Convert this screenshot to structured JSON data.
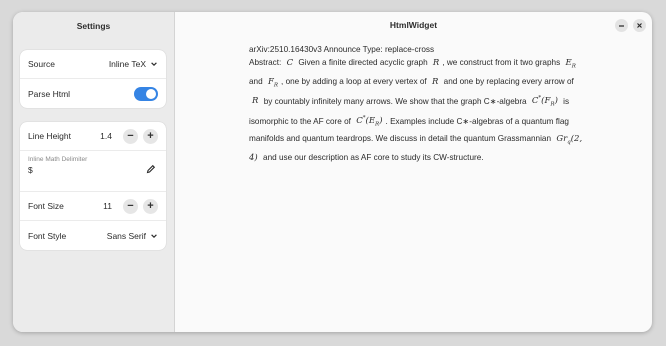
{
  "sidebar": {
    "title": "Settings",
    "source": {
      "label": "Source",
      "value": "Inline TeX"
    },
    "parse_html": {
      "label": "Parse Html",
      "enabled": true
    },
    "line_height": {
      "label": "Line Height",
      "value": "1.4",
      "minus": "−",
      "plus": "+"
    },
    "inline_math_delimiter": {
      "caption": "Inline Math Delimiter",
      "value": "$"
    },
    "font_size": {
      "label": "Font Size",
      "value": "11",
      "minus": "−",
      "plus": "+"
    },
    "font_style": {
      "label": "Font Style",
      "value": "Sans Serif"
    }
  },
  "main": {
    "title": "HtmlWidget",
    "header_line": "arXiv:2510.16430v3 Announce Type: replace-cross",
    "abstract_label": "Abstract:",
    "math": {
      "C": "C",
      "R": "R",
      "E": "E",
      "F": "F",
      "sub_R": "R",
      "cstar": "C",
      "star": "*",
      "open": "(",
      "close": ")",
      "Gr": "Gr",
      "sub_q": "q",
      "args": "(2, 4)"
    },
    "text": {
      "t1": "Given a finite directed acyclic graph",
      "t2": ", we construct from it two graphs",
      "t3": "and",
      "t4": ", one by adding a loop at every vertex of",
      "t5": "and one by replacing every arrow of",
      "t6": "by countably infinitely many arrows. We show that the graph C∗-algebra",
      "t7": "is isomorphic to the AF core of",
      "t8": ". Examples include C∗-algebras of a quantum flag manifolds and quantum teardrops. We discuss in detail the quantum Grassmannian",
      "t9": "and use our description as AF core to study its CW-structure."
    }
  },
  "colors": {
    "accent": "#3584e4"
  },
  "icons": [
    "chevron-down-icon",
    "edit-icon",
    "minimize-icon",
    "close-icon"
  ]
}
